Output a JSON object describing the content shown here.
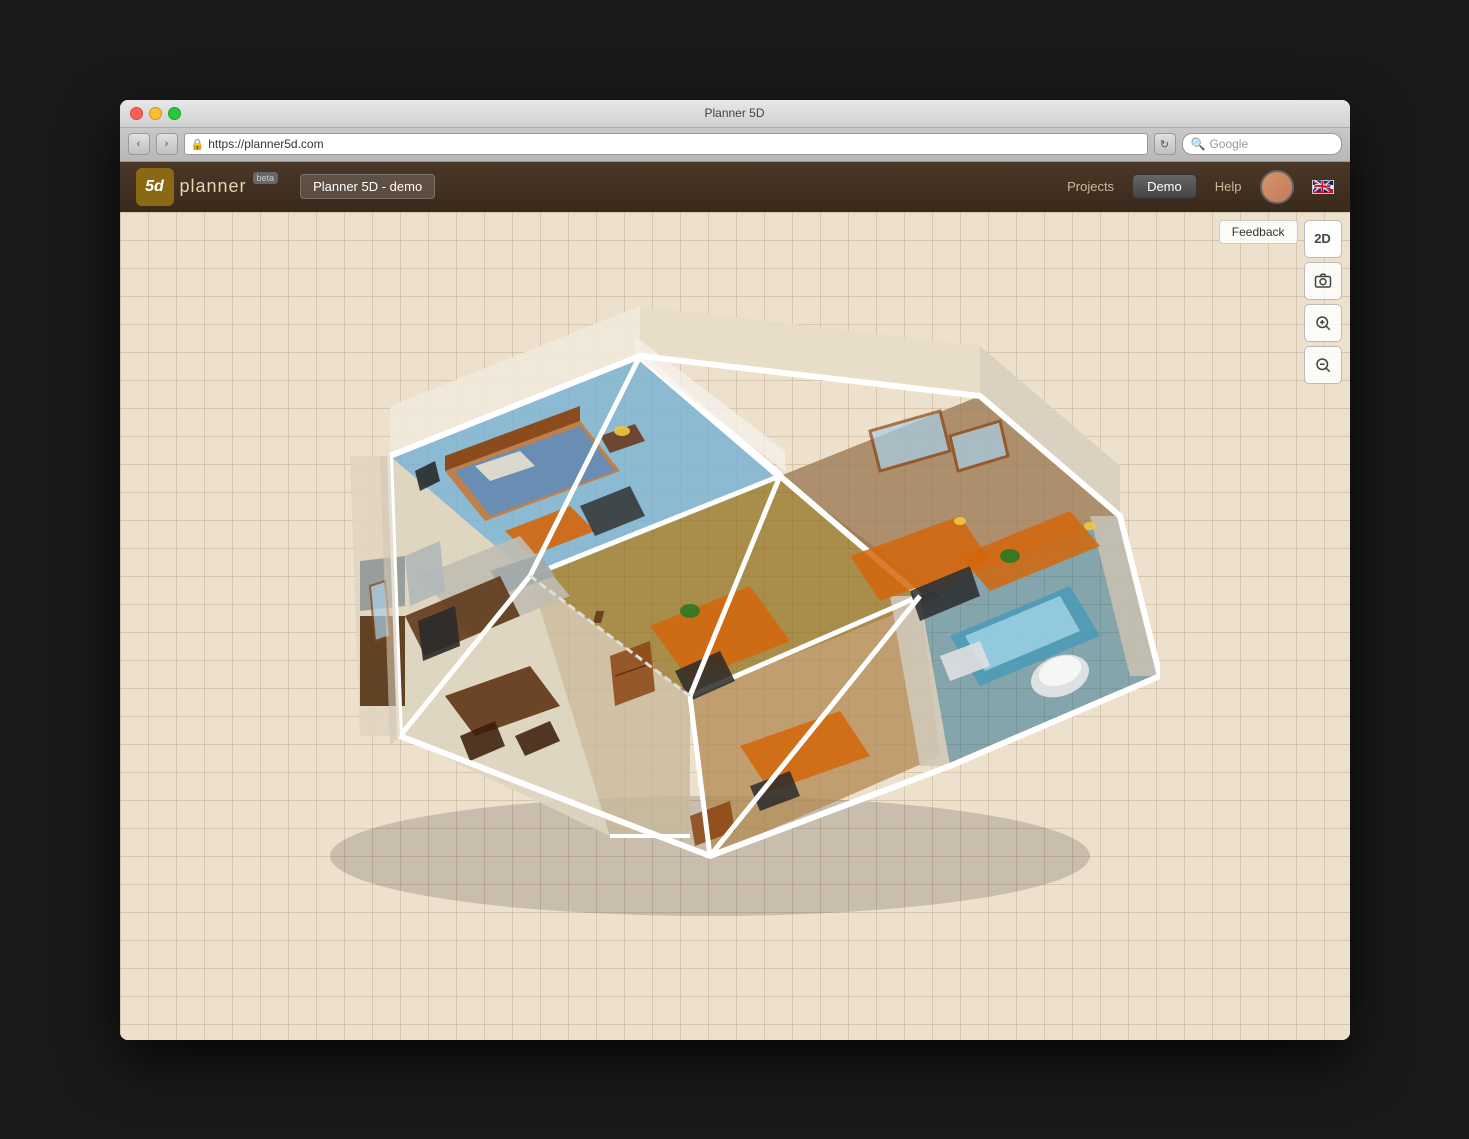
{
  "window": {
    "title": "Planner 5D"
  },
  "addressbar": {
    "back_label": "‹",
    "forward_label": "›",
    "url": "https://planner5d.com",
    "search_placeholder": "Google",
    "refresh_label": "↻"
  },
  "appbar": {
    "logo_text": "planner",
    "logo_icon_text": "5d",
    "beta_label": "beta",
    "project_name": "Planner 5D - demo",
    "nav": {
      "projects_label": "Projects",
      "demo_label": "Demo",
      "help_label": "Help"
    },
    "flag_label": "🇬🇧"
  },
  "toolbar": {
    "feedback_label": "Feedback",
    "view_2d_label": "2D",
    "screenshot_label": "📷",
    "zoom_in_label": "⊕",
    "zoom_out_label": "⊖"
  }
}
